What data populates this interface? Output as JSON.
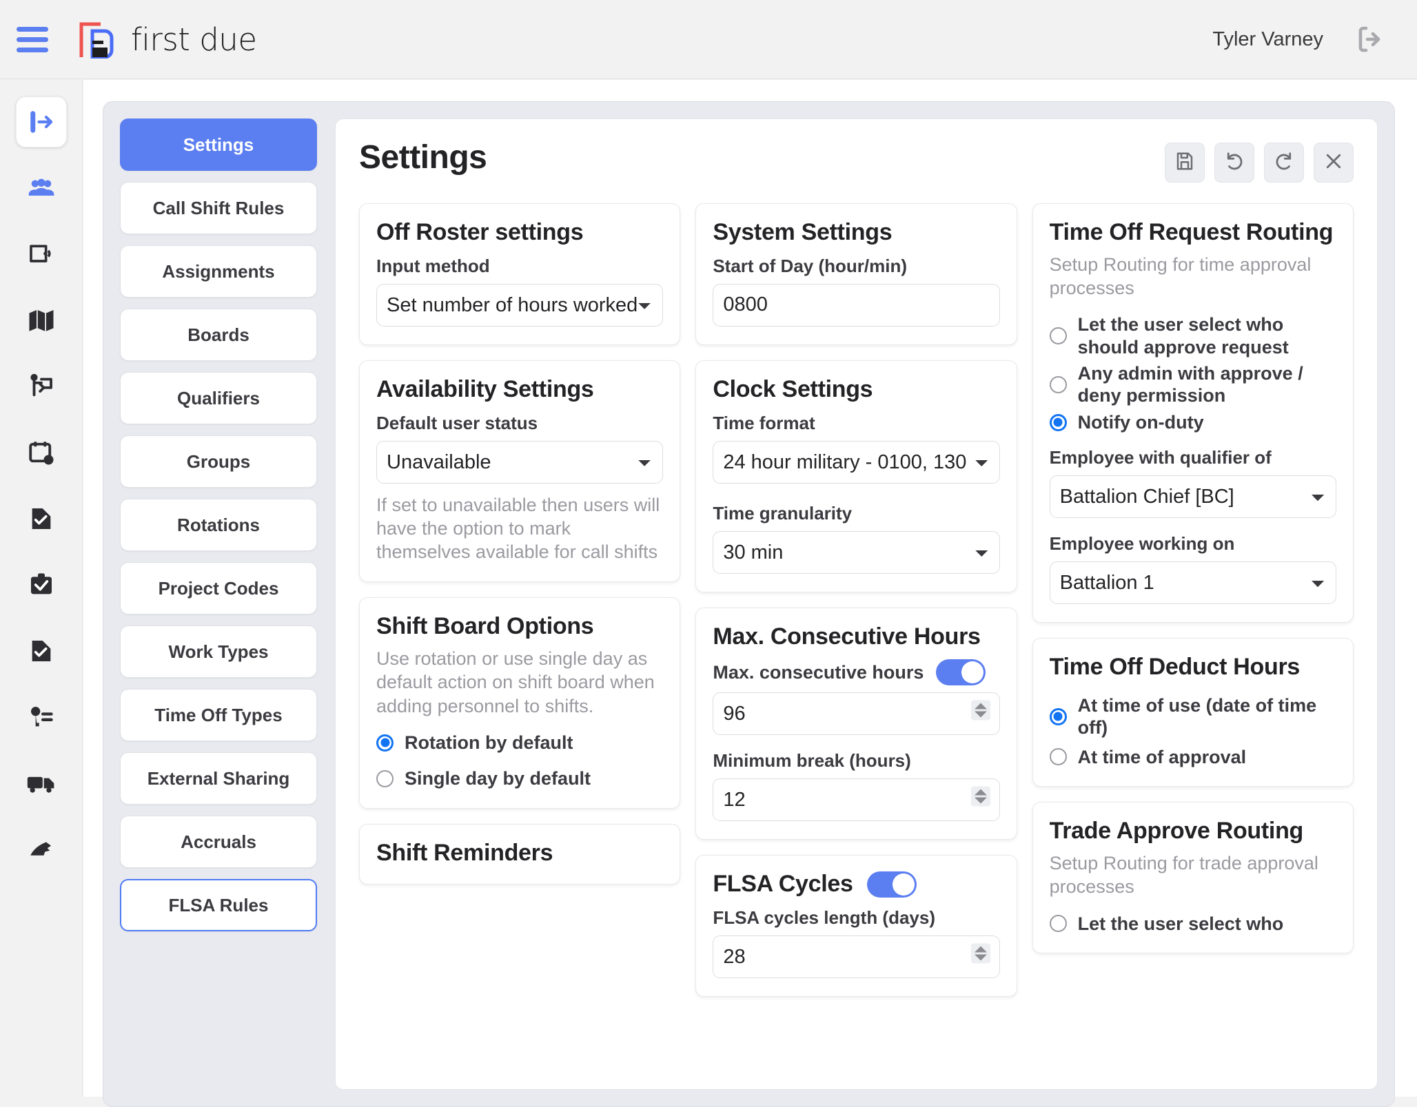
{
  "header": {
    "brand_name": "first due",
    "user_name": "Tyler Varney",
    "menu_icon": "hamburger-menu-icon",
    "logo_icon": "first-due-logo-icon",
    "logout_icon": "logout-icon"
  },
  "rail": {
    "items": [
      {
        "icon": "collapse-sidebar-icon",
        "active": true
      },
      {
        "icon": "personnel-group-icon",
        "active": false
      },
      {
        "icon": "device-icon",
        "active": false
      },
      {
        "icon": "map-icon",
        "active": false
      },
      {
        "icon": "pre-plan-icon",
        "active": false
      },
      {
        "icon": "scheduling-calendar-icon",
        "active": false
      },
      {
        "icon": "report-document-icon",
        "active": false
      },
      {
        "icon": "inspection-clipboard-icon",
        "active": false
      },
      {
        "icon": "incident-document-icon",
        "active": false
      },
      {
        "icon": "permissions-key-icon",
        "active": false
      },
      {
        "icon": "apparatus-truck-icon",
        "active": false
      },
      {
        "icon": "hydrant-icon",
        "active": false
      }
    ]
  },
  "nav": {
    "items": [
      {
        "label": "Settings",
        "state": "active"
      },
      {
        "label": "Call Shift Rules",
        "state": "default"
      },
      {
        "label": "Assignments",
        "state": "default"
      },
      {
        "label": "Boards",
        "state": "default"
      },
      {
        "label": "Qualifiers",
        "state": "default"
      },
      {
        "label": "Groups",
        "state": "default"
      },
      {
        "label": "Rotations",
        "state": "default"
      },
      {
        "label": "Project Codes",
        "state": "default"
      },
      {
        "label": "Work Types",
        "state": "default"
      },
      {
        "label": "Time Off Types",
        "state": "default"
      },
      {
        "label": "External Sharing",
        "state": "default"
      },
      {
        "label": "Accruals",
        "state": "default"
      },
      {
        "label": "FLSA Rules",
        "state": "focused"
      }
    ]
  },
  "page": {
    "title": "Settings",
    "toolbar": [
      {
        "name": "save-button",
        "icon": "save-disk-icon"
      },
      {
        "name": "undo-button",
        "icon": "undo-arrow-icon"
      },
      {
        "name": "redo-button",
        "icon": "redo-arrow-icon"
      },
      {
        "name": "close-button",
        "icon": "close-x-icon"
      }
    ]
  },
  "cards": {
    "off_roster": {
      "title": "Off Roster settings",
      "input_method_label": "Input method",
      "input_method_value": "Set number of hours worked"
    },
    "availability": {
      "title": "Availability Settings",
      "default_status_label": "Default user status",
      "default_status_value": "Unavailable",
      "help": "If set to unavailable then users will have the option to mark themselves available for call shifts"
    },
    "shift_board": {
      "title": "Shift Board Options",
      "description": "Use rotation or use single day as default action on shift board when adding personnel to shifts.",
      "options": [
        {
          "label": "Rotation by default",
          "checked": true
        },
        {
          "label": "Single day by default",
          "checked": false
        }
      ]
    },
    "shift_reminders": {
      "title": "Shift Reminders"
    },
    "system_settings": {
      "title": "System Settings",
      "start_of_day_label": "Start of Day (hour/min)",
      "start_of_day_value": "0800"
    },
    "clock_settings": {
      "title": "Clock Settings",
      "time_format_label": "Time format",
      "time_format_value": "24 hour military - 0100, 130",
      "time_granularity_label": "Time granularity",
      "time_granularity_value": "30 min"
    },
    "max_consecutive": {
      "title": "Max. Consecutive Hours",
      "toggle_label": "Max. consecutive hours",
      "toggle_on": true,
      "hours_value": "96",
      "min_break_label": "Minimum break (hours)",
      "min_break_value": "12"
    },
    "flsa_cycles": {
      "title": "FLSA Cycles",
      "toggle_on": true,
      "cycle_length_label": "FLSA cycles length (days)",
      "cycle_length_value": "28"
    },
    "time_off_routing": {
      "title": "Time Off Request Routing",
      "description": "Setup Routing for time approval processes",
      "options": [
        {
          "label": "Let the user select who should approve request",
          "checked": false
        },
        {
          "label": "Any admin with approve / deny permission",
          "checked": false
        },
        {
          "label": "Notify on-duty",
          "checked": true
        }
      ],
      "qualifier_label": "Employee with qualifier of",
      "qualifier_value": "Battalion Chief [BC]",
      "working_on_label": "Employee working on",
      "working_on_value": "Battalion 1"
    },
    "deduct_hours": {
      "title": "Time Off Deduct Hours",
      "options": [
        {
          "label": "At time of use (date of time off)",
          "checked": true
        },
        {
          "label": "At time of approval",
          "checked": false
        }
      ]
    },
    "trade_routing": {
      "title": "Trade Approve Routing",
      "description": "Setup Routing for trade approval processes",
      "first_option_label": "Let the user select who"
    }
  },
  "colors": {
    "accent_blue": "#5b7ef0",
    "radio_blue": "#1274f3",
    "logo_red": "#ef5350",
    "muted_text": "#9a9aa0",
    "panel_bg": "#e9eaef"
  }
}
